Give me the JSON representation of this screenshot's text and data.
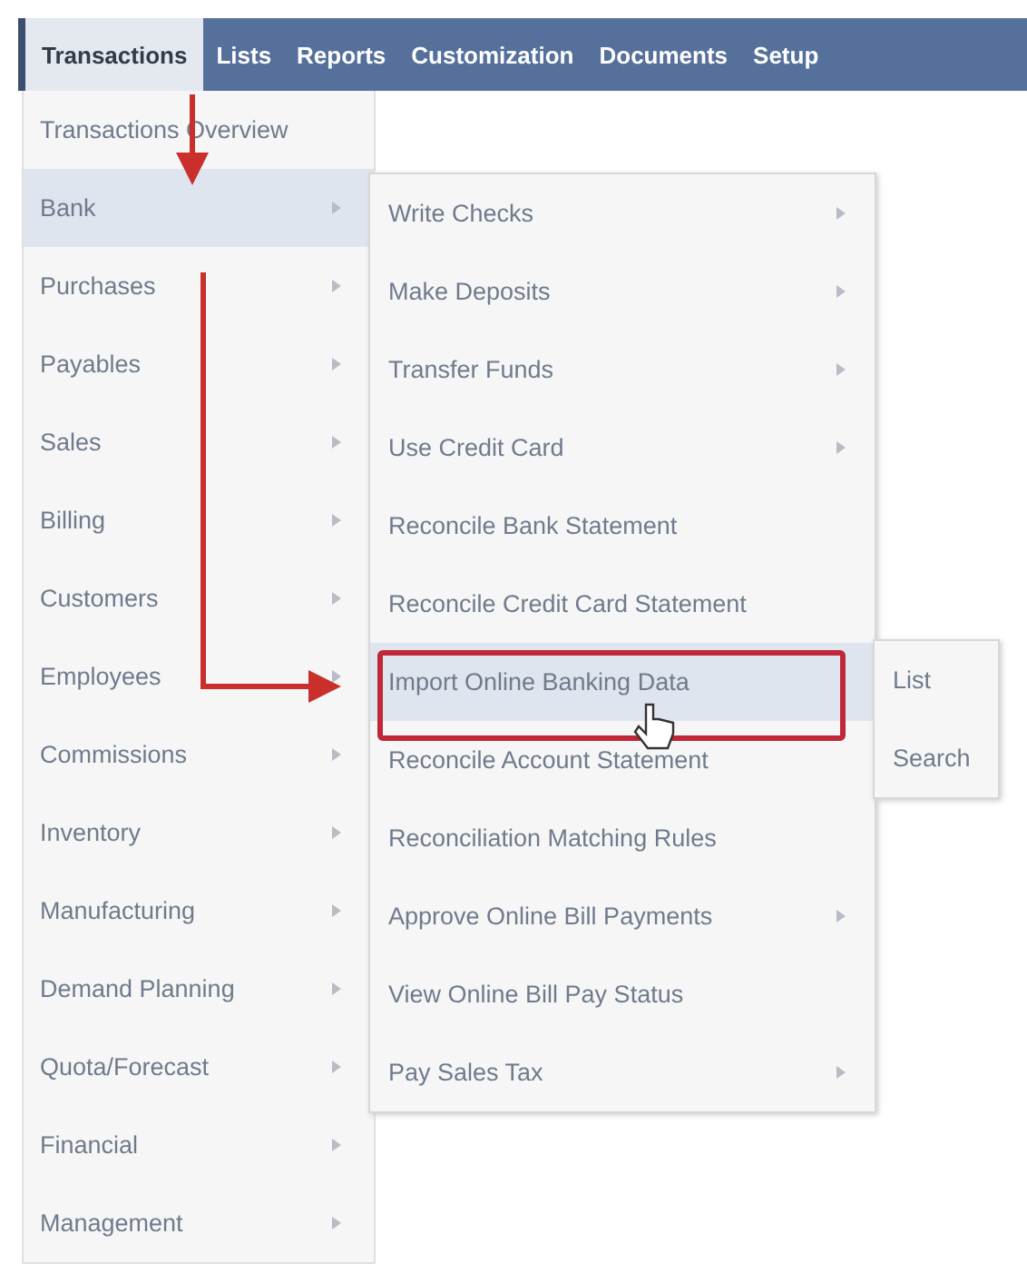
{
  "nav_tabs": [
    {
      "label": "Transactions",
      "selected": true
    },
    {
      "label": "Lists",
      "selected": false
    },
    {
      "label": "Reports",
      "selected": false
    },
    {
      "label": "Customization",
      "selected": false
    },
    {
      "label": "Documents",
      "selected": false
    },
    {
      "label": "Setup",
      "selected": false
    }
  ],
  "menu": [
    {
      "label": "Transactions Overview",
      "has_submenu": false,
      "selected": false
    },
    {
      "label": "Bank",
      "has_submenu": true,
      "selected": true
    },
    {
      "label": "Purchases",
      "has_submenu": true,
      "selected": false
    },
    {
      "label": "Payables",
      "has_submenu": true,
      "selected": false
    },
    {
      "label": "Sales",
      "has_submenu": true,
      "selected": false
    },
    {
      "label": "Billing",
      "has_submenu": true,
      "selected": false
    },
    {
      "label": "Customers",
      "has_submenu": true,
      "selected": false
    },
    {
      "label": "Employees",
      "has_submenu": true,
      "selected": false
    },
    {
      "label": "Commissions",
      "has_submenu": true,
      "selected": false
    },
    {
      "label": "Inventory",
      "has_submenu": true,
      "selected": false
    },
    {
      "label": "Manufacturing",
      "has_submenu": true,
      "selected": false
    },
    {
      "label": "Demand Planning",
      "has_submenu": true,
      "selected": false
    },
    {
      "label": "Quota/Forecast",
      "has_submenu": true,
      "selected": false
    },
    {
      "label": "Financial",
      "has_submenu": true,
      "selected": false
    },
    {
      "label": "Management",
      "has_submenu": true,
      "selected": false
    }
  ],
  "submenu": [
    {
      "label": "Write Checks",
      "has_submenu": true,
      "selected": false
    },
    {
      "label": "Make Deposits",
      "has_submenu": true,
      "selected": false
    },
    {
      "label": "Transfer Funds",
      "has_submenu": true,
      "selected": false
    },
    {
      "label": "Use Credit Card",
      "has_submenu": true,
      "selected": false
    },
    {
      "label": "Reconcile Bank Statement",
      "has_submenu": false,
      "selected": false
    },
    {
      "label": "Reconcile Credit Card Statement",
      "has_submenu": false,
      "selected": false
    },
    {
      "label": "Import Online Banking Data",
      "has_submenu": false,
      "selected": true
    },
    {
      "label": "Reconcile Account Statement",
      "has_submenu": false,
      "selected": false
    },
    {
      "label": "Reconciliation Matching Rules",
      "has_submenu": false,
      "selected": false
    },
    {
      "label": "Approve Online Bill Payments",
      "has_submenu": true,
      "selected": false
    },
    {
      "label": "View Online Bill Pay Status",
      "has_submenu": false,
      "selected": false
    },
    {
      "label": "Pay Sales Tax",
      "has_submenu": true,
      "selected": false
    }
  ],
  "flyout": [
    {
      "label": "List",
      "selected": false
    },
    {
      "label": "Search",
      "selected": false
    }
  ]
}
